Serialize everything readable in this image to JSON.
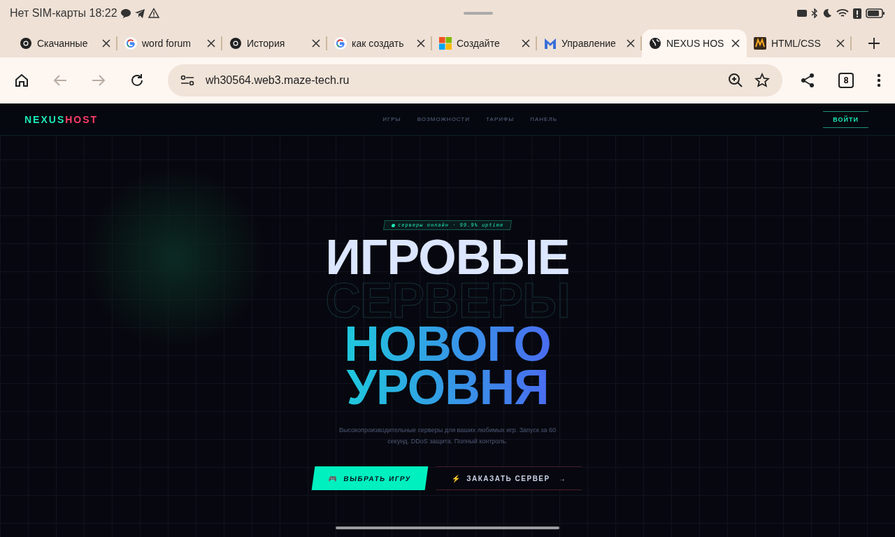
{
  "status_bar": {
    "carrier": "Нет SIM-карты",
    "time": "18:22"
  },
  "tabs": [
    {
      "label": "Скачанные",
      "kind": "chrome",
      "selected": false
    },
    {
      "label": "word forum",
      "kind": "google",
      "selected": false
    },
    {
      "label": "История",
      "kind": "chrome",
      "selected": false
    },
    {
      "label": "как создать",
      "kind": "google",
      "selected": false
    },
    {
      "label": "Создайте",
      "kind": "windows",
      "selected": false
    },
    {
      "label": "Управление",
      "kind": "m",
      "selected": false
    },
    {
      "label": "NEXUS HOS",
      "kind": "globe",
      "selected": true
    },
    {
      "label": "HTML/CSS",
      "kind": "rw",
      "selected": false
    }
  ],
  "address_bar": {
    "url": "wh30564.web3.maze-tech.ru",
    "tab_count": "8"
  },
  "site": {
    "logo": {
      "part1": "NEXUS",
      "part2": "HOST"
    },
    "nav": [
      "ИГРЫ",
      "ВОЗМОЖНОСТИ",
      "ТАРИФЫ",
      "ПАНЕЛЬ"
    ],
    "login": "ВОЙТИ",
    "badge": "серверы онлайн · 99.9% uptime",
    "headline": [
      {
        "text": "ИГРОВЫЕ",
        "kind": "solid"
      },
      {
        "text": "СЕРВЕРЫ",
        "kind": "outline"
      },
      {
        "text": "НОВОГО",
        "kind": "gradient"
      },
      {
        "text": "УРОВНЯ",
        "kind": "gradient"
      }
    ],
    "description": "Высокопроизводительные серверы для ваших любимых игр. Запуск за 60 секунд. DDoS защита. Полный контроль.",
    "primary_button": {
      "icon": "🎮",
      "label": "ВЫБРАТЬ ИГРУ"
    },
    "secondary_button": {
      "icon": "⚡",
      "label": "ЗАКАЗАТЬ СЕРВЕР",
      "arrow": "→"
    }
  }
}
